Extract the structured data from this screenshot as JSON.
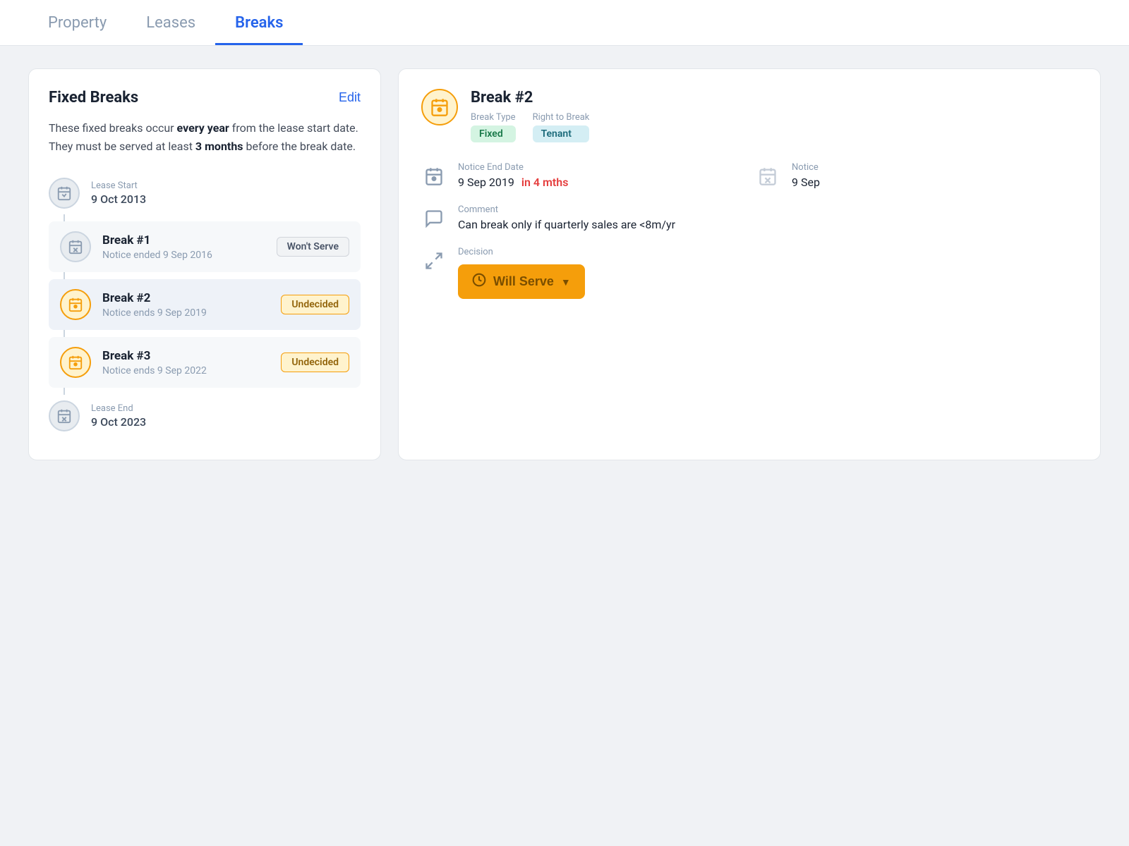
{
  "nav": {
    "tabs": [
      {
        "label": "Property",
        "active": false
      },
      {
        "label": "Leases",
        "active": false
      },
      {
        "label": "Breaks",
        "active": true
      }
    ]
  },
  "left_panel": {
    "title": "Fixed Breaks",
    "edit_label": "Edit",
    "description_plain": "These fixed breaks occur ",
    "description_bold1": "every year",
    "description_middle": " from the lease start date. They must be served at least ",
    "description_bold2": "3 months",
    "description_end": " before the break date.",
    "timeline": {
      "lease_start_label": "Lease Start",
      "lease_start_date": "9 Oct 2013",
      "lease_end_label": "Lease End",
      "lease_end_date": "9 Oct 2023",
      "breaks": [
        {
          "id": "break1",
          "title": "Break #1",
          "subtitle": "Notice ended 9 Sep 2016",
          "badge": "Won't Serve",
          "badge_type": "wont-serve",
          "selected": false,
          "icon_type": "gray"
        },
        {
          "id": "break2",
          "title": "Break #2",
          "subtitle": "Notice ends 9 Sep 2019",
          "badge": "Undecided",
          "badge_type": "undecided",
          "selected": true,
          "icon_type": "orange"
        },
        {
          "id": "break3",
          "title": "Break #3",
          "subtitle": "Notice ends 9 Sep 2022",
          "badge": "Undecided",
          "badge_type": "undecided",
          "selected": false,
          "icon_type": "orange"
        }
      ]
    }
  },
  "right_panel": {
    "break_title": "Break #2",
    "break_type_label": "Break Type",
    "break_type_value": "Fixed",
    "right_to_break_label": "Right to Break",
    "right_to_break_value": "Tenant",
    "notice_end_date_label": "Notice End Date",
    "notice_end_date_value": "9 Sep 2019",
    "notice_end_overdue": "in 4 mths",
    "notice_end_date2_label": "Notice",
    "notice_end_date2_value": "9 Sep",
    "comment_label": "Comment",
    "comment_value": "Can break only if quarterly sales are <8m/yr",
    "decision_label": "Decision",
    "decision_btn_label": "Will Serve"
  }
}
